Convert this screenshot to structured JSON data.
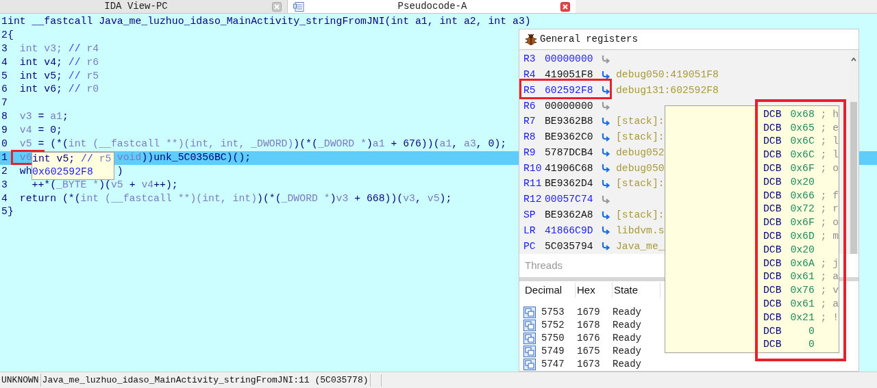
{
  "tabs": [
    {
      "label": "IDA View-PC",
      "selected": false,
      "icon": false
    },
    {
      "label": "Pseudocode-A",
      "selected": true,
      "icon": true
    }
  ],
  "code": {
    "lines": [
      {
        "number": "1",
        "highlighted": false,
        "segments": [
          {
            "kind": "code",
            "text": "int __fastcall Java_me_luzhuo_idaso_MainActivity_stringFromJNI(int a1, int a2, int a3)"
          }
        ]
      },
      {
        "number": "2",
        "highlighted": false,
        "segments": [
          {
            "kind": "code",
            "text": "{"
          }
        ]
      },
      {
        "number": "3",
        "highlighted": false,
        "segments": [
          {
            "kind": "var",
            "text": "  int v3; "
          },
          {
            "kind": "comment",
            "text": "// "
          },
          {
            "kind": "var",
            "text": "r4"
          }
        ]
      },
      {
        "number": "4",
        "highlighted": false,
        "segments": [
          {
            "kind": "code",
            "text": "  int v4; "
          },
          {
            "kind": "comment",
            "text": "// "
          },
          {
            "kind": "var",
            "text": "r6"
          }
        ]
      },
      {
        "number": "5",
        "highlighted": false,
        "segments": [
          {
            "kind": "code",
            "text": "  int v5; "
          },
          {
            "kind": "comment",
            "text": "// "
          },
          {
            "kind": "var",
            "text": "r5"
          }
        ]
      },
      {
        "number": "6",
        "highlighted": false,
        "segments": [
          {
            "kind": "code",
            "text": "  int v6; "
          },
          {
            "kind": "comment",
            "text": "// "
          },
          {
            "kind": "var",
            "text": "r0"
          }
        ]
      },
      {
        "number": "7",
        "highlighted": false
      },
      {
        "number": "8",
        "highlighted": false,
        "segments": [
          {
            "kind": "var",
            "text": "  v3"
          },
          {
            "kind": "code",
            "text": " = "
          },
          {
            "kind": "var",
            "text": "a1"
          },
          {
            "kind": "code",
            "text": ";"
          }
        ]
      },
      {
        "number": "9",
        "highlighted": false,
        "segments": [
          {
            "kind": "var",
            "text": "  v4"
          },
          {
            "kind": "code",
            "text": " = 0;"
          }
        ]
      },
      {
        "number": "0",
        "highlighted": false,
        "segments": [
          {
            "kind": "var",
            "text": "  v5"
          },
          {
            "kind": "code",
            "text": " = (*("
          },
          {
            "kind": "var",
            "text": "int (__fastcall **)(int, int, _DWORD)"
          },
          {
            "kind": "code",
            "text": ")(*("
          },
          {
            "kind": "var",
            "text": "_DWORD *"
          },
          {
            "kind": "code",
            "text": ")"
          },
          {
            "kind": "var",
            "text": "a1"
          },
          {
            "kind": "code",
            "text": " + 676))("
          },
          {
            "kind": "var",
            "text": "a1"
          },
          {
            "kind": "code",
            "text": ", "
          },
          {
            "kind": "var",
            "text": "a3"
          },
          {
            "kind": "code",
            "text": ", 0);"
          }
        ]
      },
      {
        "number": "1",
        "highlighted": true,
        "segments": [
          {
            "kind": "var",
            "text": "  v6"
          },
          {
            "kind": "covered"
          },
          {
            "kind": "var",
            "text": "void"
          },
          {
            "kind": "code",
            "text": "))unk_5C0356BC)();"
          }
        ]
      },
      {
        "number": "2",
        "highlighted": false,
        "segments": [
          {
            "kind": "code",
            "text": "  wh"
          },
          {
            "kind": "covered"
          },
          {
            "kind": "code",
            "text": ")"
          }
        ]
      },
      {
        "number": "3",
        "highlighted": false,
        "segments": [
          {
            "kind": "code",
            "text": "    ++*("
          },
          {
            "kind": "var",
            "text": "_BYTE *"
          },
          {
            "kind": "code",
            "text": ")("
          },
          {
            "kind": "var",
            "text": "v5"
          },
          {
            "kind": "code",
            "text": " + "
          },
          {
            "kind": "var",
            "text": "v4"
          },
          {
            "kind": "code",
            "text": "++);"
          }
        ]
      },
      {
        "number": "4",
        "highlighted": false,
        "segments": [
          {
            "kind": "code",
            "text": "  return (*("
          },
          {
            "kind": "var",
            "text": "int (__fastcall **)(int, int)"
          },
          {
            "kind": "code",
            "text": ")(*("
          },
          {
            "kind": "var",
            "text": "_DWORD *"
          },
          {
            "kind": "code",
            "text": ")"
          },
          {
            "kind": "var",
            "text": "v3"
          },
          {
            "kind": "code",
            "text": " + 668))("
          },
          {
            "kind": "var",
            "text": "v3"
          },
          {
            "kind": "code",
            "text": ", "
          },
          {
            "kind": "var",
            "text": "v5"
          },
          {
            "kind": "code",
            "text": ");"
          }
        ]
      },
      {
        "number": "5",
        "highlighted": false,
        "segments": [
          {
            "kind": "code",
            "text": "}"
          }
        ]
      }
    ]
  },
  "hover_tooltip": {
    "lines": [
      {
        "segments": [
          {
            "kind": "code",
            "text": "int v5; "
          },
          {
            "kind": "comment",
            "text": "// "
          },
          {
            "kind": "var",
            "text": "r5"
          }
        ]
      },
      {
        "segments": [
          {
            "kind": "value",
            "text": "0x602592F8"
          }
        ]
      }
    ]
  },
  "registers": {
    "title": "General registers",
    "rows": [
      {
        "name": "R3",
        "value": "00000000",
        "changed": true,
        "has_target": false
      },
      {
        "name": "R4",
        "value": "419051F8",
        "changed": false,
        "has_target": true,
        "target": "debug050:419051F8"
      },
      {
        "name": "R5",
        "value": "602592F8",
        "changed": true,
        "has_target": true,
        "target": "debug131:602592F8"
      },
      {
        "name": "R6",
        "value": "00000000",
        "changed": false,
        "has_target": false
      },
      {
        "name": "R7",
        "value": "BE9362B8",
        "changed": false,
        "has_target": true,
        "target": "[stack]:"
      },
      {
        "name": "R8",
        "value": "BE9362C0",
        "changed": false,
        "has_target": true,
        "target": "[stack]:"
      },
      {
        "name": "R9",
        "value": "5787DCB4",
        "changed": false,
        "has_target": true,
        "target": "debug052"
      },
      {
        "name": "R10",
        "value": "41906C68",
        "changed": false,
        "has_target": true,
        "target": "debug050"
      },
      {
        "name": "R11",
        "value": "BE9362D4",
        "changed": false,
        "has_target": true,
        "target": "[stack]:"
      },
      {
        "name": "R12",
        "value": "00057C74",
        "changed": true,
        "has_target": false
      },
      {
        "name": "SP",
        "value": "BE9362A8",
        "changed": false,
        "has_target": true,
        "target": "[stack]:"
      },
      {
        "name": "LR",
        "value": "41866C9D",
        "changed": true,
        "has_target": true,
        "target": "libdvm.s"
      },
      {
        "name": "PC",
        "value": "5C035794",
        "changed": false,
        "has_target": true,
        "target": "Java_me_"
      }
    ]
  },
  "memory_tooltip": {
    "rows": [
      {
        "op": "DCB",
        "value": "0x68",
        "comment": "; h"
      },
      {
        "op": "DCB",
        "value": "0x65",
        "comment": "; e"
      },
      {
        "op": "DCB",
        "value": "0x6C",
        "comment": "; l"
      },
      {
        "op": "DCB",
        "value": "0x6C",
        "comment": "; l"
      },
      {
        "op": "DCB",
        "value": "0x6F",
        "comment": "; o"
      },
      {
        "op": "DCB",
        "value": "0x20"
      },
      {
        "op": "DCB",
        "value": "0x66",
        "comment": "; f"
      },
      {
        "op": "DCB",
        "value": "0x72",
        "comment": "; r"
      },
      {
        "op": "DCB",
        "value": "0x6F",
        "comment": "; o"
      },
      {
        "op": "DCB",
        "value": "0x6D",
        "comment": "; m"
      },
      {
        "op": "DCB",
        "value": "0x20"
      },
      {
        "op": "DCB",
        "value": "0x6A",
        "comment": "; j"
      },
      {
        "op": "DCB",
        "value": "0x61",
        "comment": "; a"
      },
      {
        "op": "DCB",
        "value": "0x76",
        "comment": "; v"
      },
      {
        "op": "DCB",
        "value": "0x61",
        "comment": "; a"
      },
      {
        "op": "DCB",
        "value": "0x21",
        "comment": "; !"
      },
      {
        "op": "DCB",
        "value": "0"
      },
      {
        "op": "DCB",
        "value": "0"
      }
    ]
  },
  "threads": {
    "title": "Threads",
    "columns": [
      "Decimal",
      "Hex",
      "State"
    ],
    "rows": [
      [
        "5753",
        "1679",
        "Ready"
      ],
      [
        "5752",
        "1678",
        "Ready"
      ],
      [
        "5750",
        "1676",
        "Ready"
      ],
      [
        "5749",
        "1675",
        "Ready"
      ],
      [
        "5747",
        "1673",
        "Ready"
      ]
    ]
  },
  "status_bar": [
    "UNKNOWN",
    "Java_me_luzhuo_idaso_MainActivity_stringFromJNI:11 (5C035778)"
  ]
}
